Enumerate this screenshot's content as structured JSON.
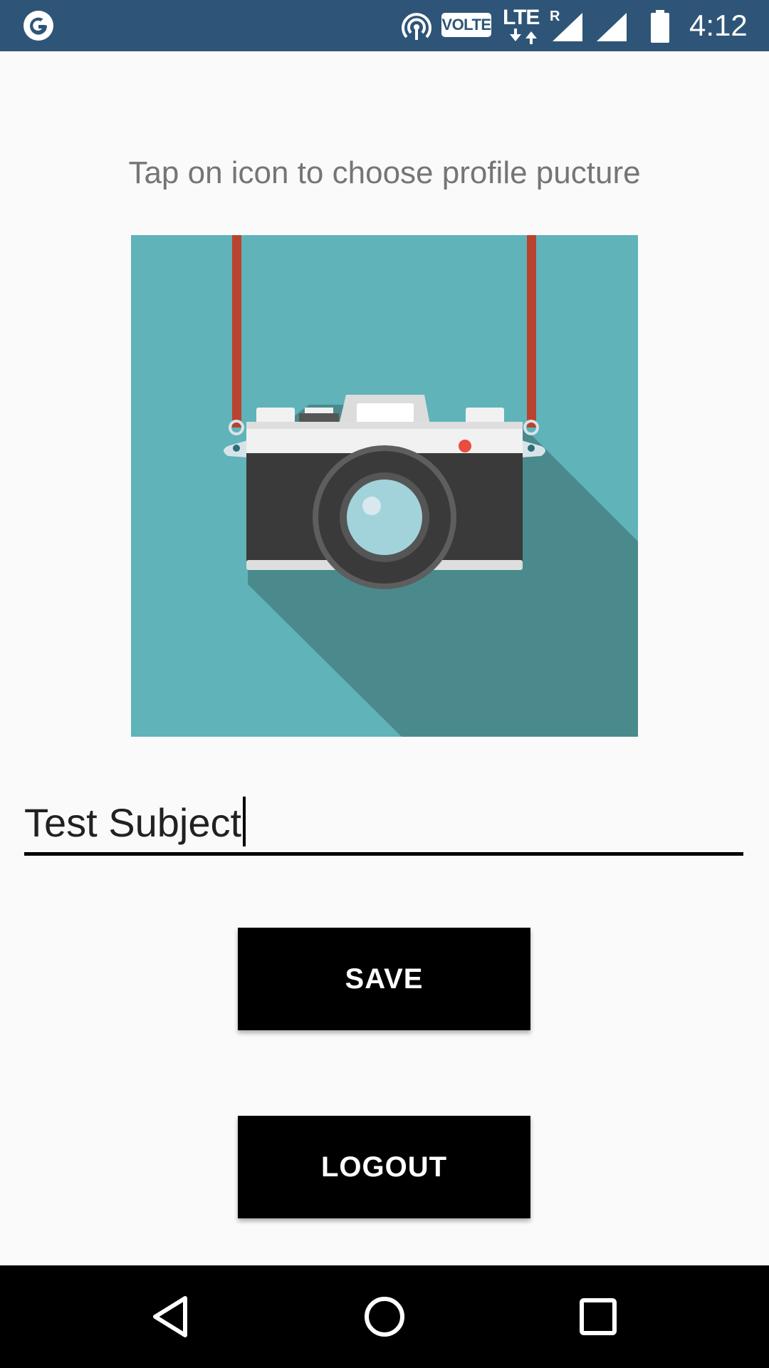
{
  "status_bar": {
    "volte": "VOLTE",
    "lte": "LTE",
    "roaming": "R",
    "time": "4:12",
    "background_color": "#2e5577",
    "icons": [
      "google-icon",
      "hotspot-icon",
      "volte-badge",
      "lte-icon",
      "signal-icon",
      "signal-icon",
      "battery-icon"
    ]
  },
  "instruction": "Tap on icon to choose profile pucture",
  "profile_picture": {
    "icon": "camera-icon",
    "background_color": "#5fb3b9"
  },
  "name_field": {
    "value": "Test Subject"
  },
  "buttons": {
    "save_label": "SAVE",
    "logout_label": "LOGOUT"
  },
  "nav_bar": {
    "icons": [
      "back-icon",
      "home-icon",
      "recents-icon"
    ]
  }
}
